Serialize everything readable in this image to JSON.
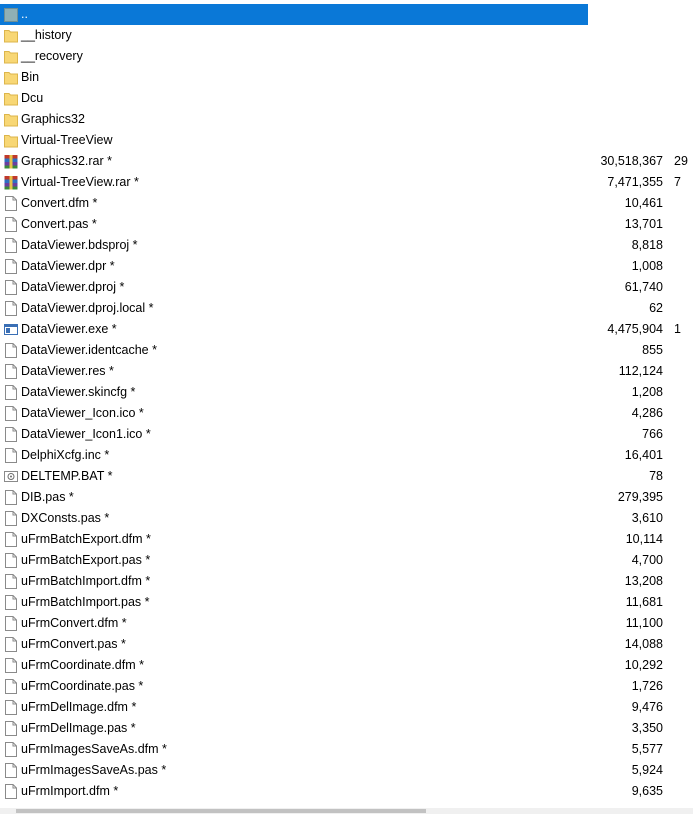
{
  "files": [
    {
      "name": "..",
      "size": "",
      "extra": "",
      "icon": "parent-dir-icon",
      "selected": true
    },
    {
      "name": "__history",
      "size": "",
      "extra": "",
      "icon": "folder-icon"
    },
    {
      "name": "__recovery",
      "size": "",
      "extra": "",
      "icon": "folder-icon"
    },
    {
      "name": "Bin",
      "size": "",
      "extra": "",
      "icon": "folder-icon"
    },
    {
      "name": "Dcu",
      "size": "",
      "extra": "",
      "icon": "folder-icon"
    },
    {
      "name": "Graphics32",
      "size": "",
      "extra": "",
      "icon": "folder-icon"
    },
    {
      "name": "Virtual-TreeView",
      "size": "",
      "extra": "",
      "icon": "folder-icon"
    },
    {
      "name": "Graphics32.rar *",
      "size": "30,518,367",
      "extra": "29",
      "icon": "rar-archive-icon"
    },
    {
      "name": "Virtual-TreeView.rar *",
      "size": "7,471,355",
      "extra": "7",
      "icon": "rar-archive-icon"
    },
    {
      "name": "Convert.dfm *",
      "size": "10,461",
      "extra": "",
      "icon": "file-icon"
    },
    {
      "name": "Convert.pas *",
      "size": "13,701",
      "extra": "",
      "icon": "file-icon"
    },
    {
      "name": "DataViewer.bdsproj *",
      "size": "8,818",
      "extra": "",
      "icon": "file-icon"
    },
    {
      "name": "DataViewer.dpr *",
      "size": "1,008",
      "extra": "",
      "icon": "file-icon"
    },
    {
      "name": "DataViewer.dproj *",
      "size": "61,740",
      "extra": "",
      "icon": "file-icon"
    },
    {
      "name": "DataViewer.dproj.local *",
      "size": "62",
      "extra": "",
      "icon": "file-icon"
    },
    {
      "name": "DataViewer.exe *",
      "size": "4,475,904",
      "extra": "1",
      "icon": "exe-icon"
    },
    {
      "name": "DataViewer.identcache *",
      "size": "855",
      "extra": "",
      "icon": "file-icon"
    },
    {
      "name": "DataViewer.res *",
      "size": "112,124",
      "extra": "",
      "icon": "file-icon"
    },
    {
      "name": "DataViewer.skincfg *",
      "size": "1,208",
      "extra": "",
      "icon": "file-icon"
    },
    {
      "name": "DataViewer_Icon.ico *",
      "size": "4,286",
      "extra": "",
      "icon": "file-icon"
    },
    {
      "name": "DataViewer_Icon1.ico *",
      "size": "766",
      "extra": "",
      "icon": "file-icon"
    },
    {
      "name": "DelphiXcfg.inc *",
      "size": "16,401",
      "extra": "",
      "icon": "file-icon"
    },
    {
      "name": "DELTEMP.BAT *",
      "size": "78",
      "extra": "",
      "icon": "batch-file-icon"
    },
    {
      "name": "DIB.pas *",
      "size": "279,395",
      "extra": "",
      "icon": "file-icon"
    },
    {
      "name": "DXConsts.pas *",
      "size": "3,610",
      "extra": "",
      "icon": "file-icon"
    },
    {
      "name": "uFrmBatchExport.dfm *",
      "size": "10,114",
      "extra": "",
      "icon": "file-icon"
    },
    {
      "name": "uFrmBatchExport.pas *",
      "size": "4,700",
      "extra": "",
      "icon": "file-icon"
    },
    {
      "name": "uFrmBatchImport.dfm *",
      "size": "13,208",
      "extra": "",
      "icon": "file-icon"
    },
    {
      "name": "uFrmBatchImport.pas *",
      "size": "11,681",
      "extra": "",
      "icon": "file-icon"
    },
    {
      "name": "uFrmConvert.dfm *",
      "size": "11,100",
      "extra": "",
      "icon": "file-icon"
    },
    {
      "name": "uFrmConvert.pas *",
      "size": "14,088",
      "extra": "",
      "icon": "file-icon"
    },
    {
      "name": "uFrmCoordinate.dfm *",
      "size": "10,292",
      "extra": "",
      "icon": "file-icon"
    },
    {
      "name": "uFrmCoordinate.pas *",
      "size": "1,726",
      "extra": "",
      "icon": "file-icon"
    },
    {
      "name": "uFrmDelImage.dfm *",
      "size": "9,476",
      "extra": "",
      "icon": "file-icon"
    },
    {
      "name": "uFrmDelImage.pas *",
      "size": "3,350",
      "extra": "",
      "icon": "file-icon"
    },
    {
      "name": "uFrmImagesSaveAs.dfm *",
      "size": "5,577",
      "extra": "",
      "icon": "file-icon"
    },
    {
      "name": "uFrmImagesSaveAs.pas *",
      "size": "5,924",
      "extra": "",
      "icon": "file-icon"
    },
    {
      "name": "uFrmImport.dfm *",
      "size": "9,635",
      "extra": "",
      "icon": "file-icon"
    }
  ],
  "colors": {
    "selection": "#0a78d7",
    "folder": "#f5d67a",
    "file_border": "#8a8a8a"
  }
}
